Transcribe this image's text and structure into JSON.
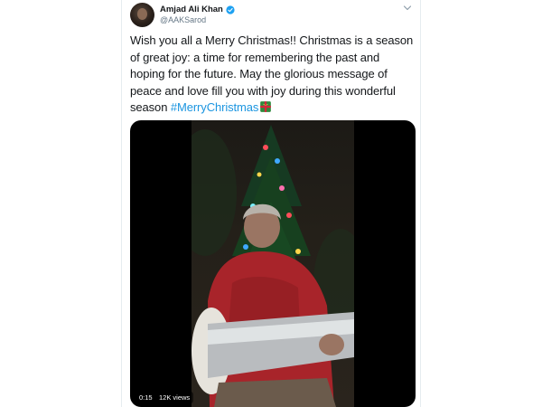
{
  "tweet": {
    "display_name": "Amjad Ali Khan",
    "handle": "@AAKSarod",
    "text_lines": [
      "Wish you all a Merry Christmas!! Christmas is a season",
      "of great joy: a time for remembering the past and",
      "hoping for the future. May the glorious message of",
      "peace and love fill you with joy during this wonderful"
    ],
    "last_line_prefix": "season ",
    "hashtag": "#MerryChristmas",
    "emoji": "gift-icon"
  },
  "video": {
    "elapsed": "0:15",
    "views": "12K views"
  },
  "colors": {
    "link": "#1b95e0",
    "text": "#14171a",
    "secondary": "#657786",
    "verified": "#1da1f2"
  },
  "icons": {
    "verified": "verified-badge-icon",
    "chevron": "chevron-down-icon",
    "gift": "gift-icon"
  }
}
